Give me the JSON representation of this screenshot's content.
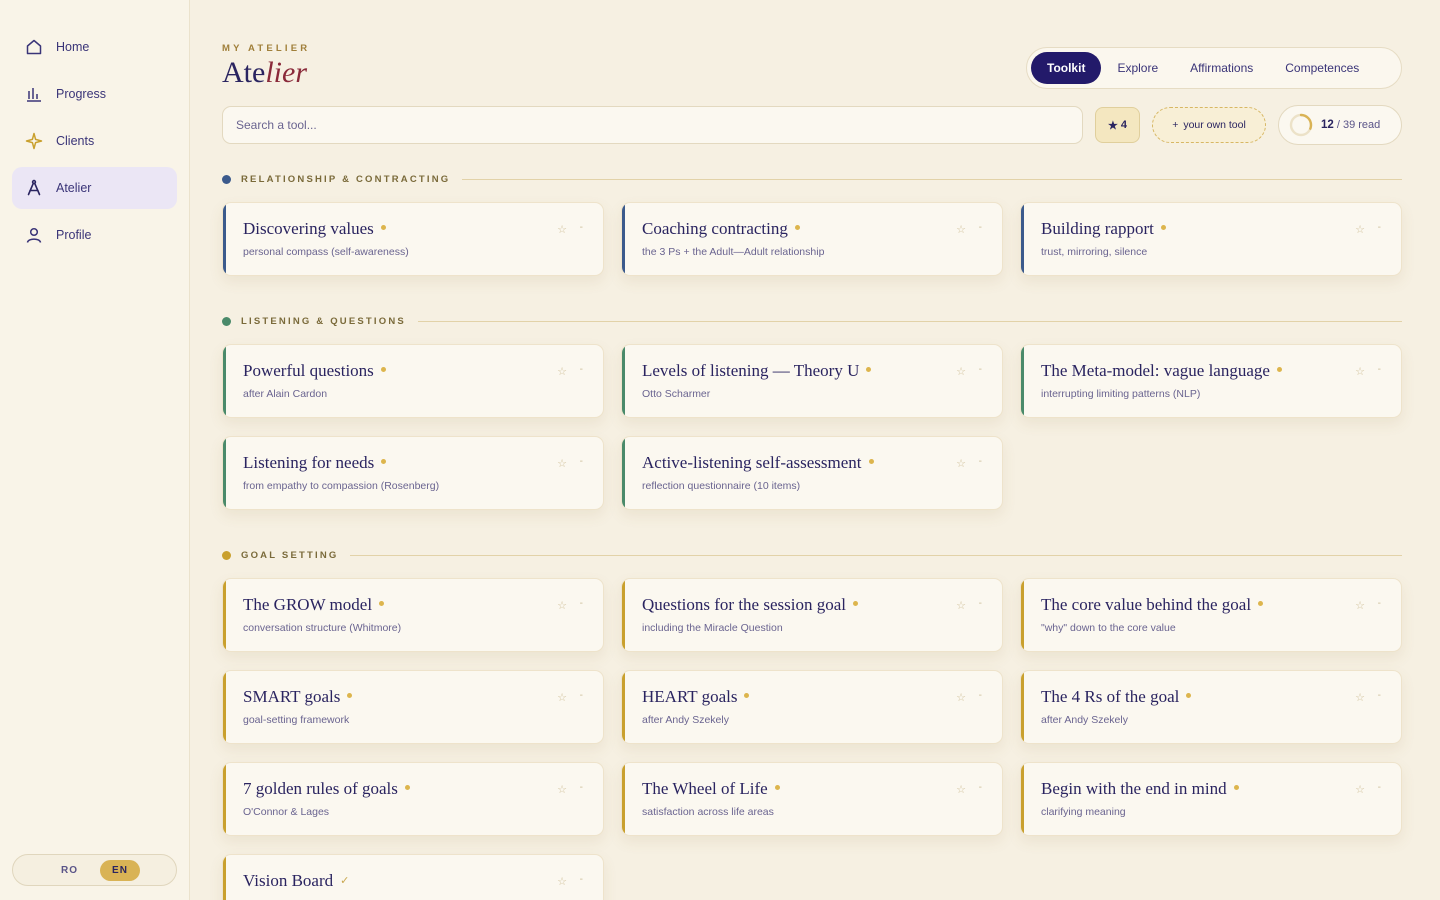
{
  "sidebar": {
    "items": [
      {
        "label": "Home",
        "icon": "home-icon",
        "active": false
      },
      {
        "label": "Progress",
        "icon": "bar-chart-icon",
        "active": false
      },
      {
        "label": "Clients",
        "icon": "sparkle-icon",
        "active": false
      },
      {
        "label": "Atelier",
        "icon": "compass-icon",
        "active": true
      },
      {
        "label": "Profile",
        "icon": "user-icon",
        "active": false
      }
    ],
    "lang": {
      "ro": "RO",
      "en": "EN",
      "active": "EN"
    }
  },
  "header": {
    "eyebrow": "MY ATELIER",
    "title_plain": "Ate",
    "title_italic": "lier"
  },
  "tabs": [
    {
      "label": "Toolkit",
      "active": true
    },
    {
      "label": "Explore",
      "active": false
    },
    {
      "label": "Affirmations",
      "active": false
    },
    {
      "label": "Competences",
      "active": false
    }
  ],
  "toolbar": {
    "search_placeholder": "Search a tool...",
    "fav_star": "★",
    "fav_count": "4",
    "own_tool_plus": "+",
    "own_tool_label": "your own tool",
    "read_count": "12",
    "read_total": "/ 39 read",
    "read_progress": 0.3077
  },
  "colors": {
    "accent": "#231a6a",
    "gold": "#ddb54d",
    "relationship": "#3b5a8c",
    "listening": "#4a8a6a",
    "goal": "#c9a02e"
  },
  "sections": [
    {
      "label": "RELATIONSHIP & CONTRACTING",
      "color": "#3b5a8c",
      "cards": [
        {
          "title": "Discovering values",
          "sub": "personal compass (self-awareness)",
          "mark": "dot"
        },
        {
          "title": "Coaching contracting",
          "sub": "the 3 Ps + the Adult—Adult relationship",
          "mark": "dot"
        },
        {
          "title": "Building rapport",
          "sub": "trust, mirroring, silence",
          "mark": "dot"
        }
      ]
    },
    {
      "label": "LISTENING & QUESTIONS",
      "color": "#4a8a6a",
      "cards": [
        {
          "title": "Powerful questions",
          "sub": "after Alain Cardon",
          "mark": "dot"
        },
        {
          "title": "Levels of listening — Theory U",
          "sub": "Otto Scharmer",
          "mark": "dot"
        },
        {
          "title": "The Meta-model: vague language",
          "sub": "interrupting limiting patterns (NLP)",
          "mark": "dot"
        },
        {
          "title": "Listening for needs",
          "sub": "from empathy to compassion (Rosenberg)",
          "mark": "dot"
        },
        {
          "title": "Active-listening self-assessment",
          "sub": "reflection questionnaire (10 items)",
          "mark": "dot"
        }
      ]
    },
    {
      "label": "GOAL SETTING",
      "color": "#c9a02e",
      "cards": [
        {
          "title": "The GROW model",
          "sub": "conversation structure (Whitmore)",
          "mark": "dot"
        },
        {
          "title": "Questions for the session goal",
          "sub": "including the Miracle Question",
          "mark": "dot"
        },
        {
          "title": "The core value behind the goal",
          "sub": "\"why\" down to the core value",
          "mark": "dot"
        },
        {
          "title": "SMART goals",
          "sub": "goal-setting framework",
          "mark": "dot"
        },
        {
          "title": "HEART goals",
          "sub": "after Andy Szekely",
          "mark": "dot"
        },
        {
          "title": "The 4 Rs of the goal",
          "sub": "after Andy Szekely",
          "mark": "dot"
        },
        {
          "title": "7 golden rules of goals",
          "sub": "O'Connor & Lages",
          "mark": "dot"
        },
        {
          "title": "The Wheel of Life",
          "sub": "satisfaction across life areas",
          "mark": "dot"
        },
        {
          "title": "Begin with the end in mind",
          "sub": "clarifying meaning",
          "mark": "dot"
        },
        {
          "title": "Vision Board",
          "sub": "",
          "mark": "check"
        }
      ]
    }
  ],
  "card_star": "☆",
  "card_dash": "-"
}
